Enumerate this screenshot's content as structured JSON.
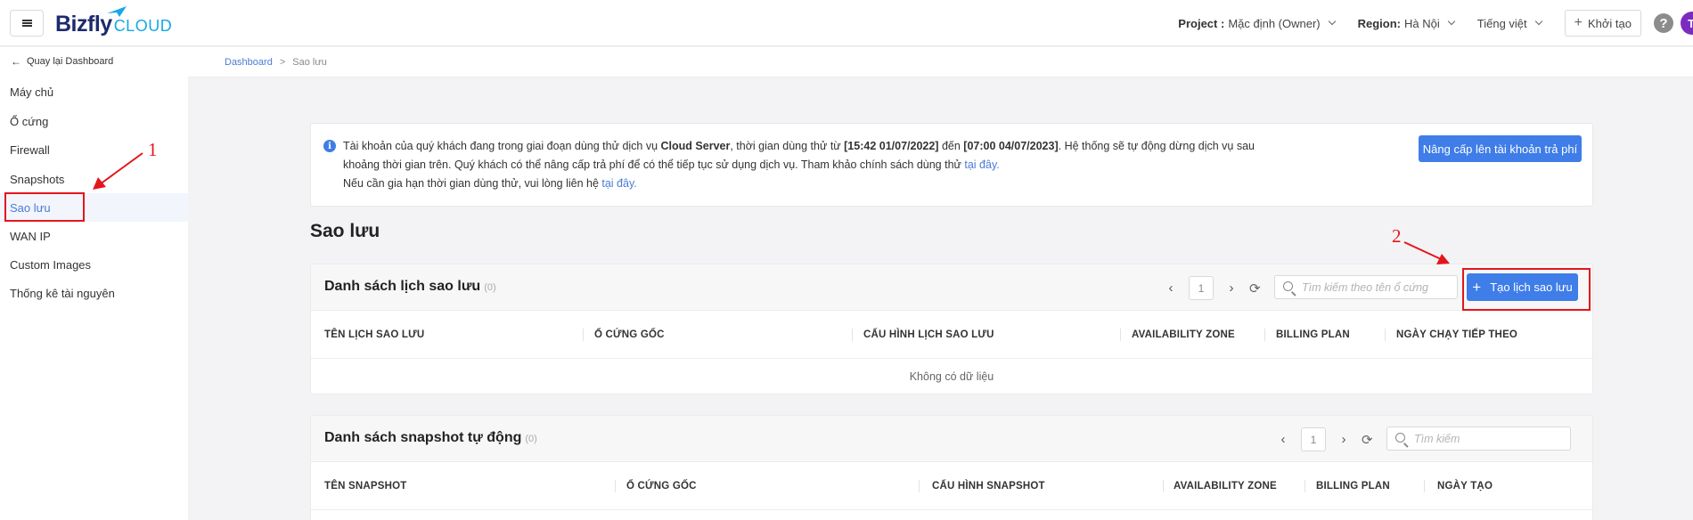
{
  "header": {
    "logo_main": "Bizfly",
    "logo_sub": "CLOUD",
    "project_label": "Project :",
    "project_value": "Mặc định (Owner)",
    "region_label": "Region:",
    "region_value": "Hà Nội",
    "language": "Tiếng việt",
    "create_label": "Khởi tạo",
    "help": "?",
    "avatar": "T"
  },
  "sidebar": {
    "back_label": "Quay lại Dashboard",
    "items": [
      {
        "label": "Máy chủ"
      },
      {
        "label": "Ổ cứng"
      },
      {
        "label": "Firewall"
      },
      {
        "label": "Snapshots"
      },
      {
        "label": "Sao lưu"
      },
      {
        "label": "WAN IP"
      },
      {
        "label": "Custom Images"
      },
      {
        "label": "Thống kê tài nguyên"
      }
    ]
  },
  "breadcrumb": {
    "home": "Dashboard",
    "separator": ">",
    "current": "Sao lưu"
  },
  "notice": {
    "t1": "Tài khoản của quý khách đang trong giai đoạn dùng thử dịch vụ ",
    "b1": "Cloud Server",
    "t2": ", thời gian dùng thử từ ",
    "b2": "[15:42 01/07/2022]",
    "t3": " đến ",
    "b3": "[07:00 04/07/2023]",
    "t4": ". Hệ thống sẽ tự động dừng dịch vụ sau khoảng thời gian trên. Quý khách có thể nâng cấp trả phí để có thể tiếp tục sử dụng dịch vụ. Tham khảo chính sách dùng thử ",
    "link1": "tại đây.",
    "t5": "Nếu cần gia hạn thời gian dùng thử, vui lòng liên hệ ",
    "link2": "tại đây.",
    "upgrade_label": "Nâng cấp lên tài khoản trả phí"
  },
  "page_title": "Sao lưu",
  "backup_panel": {
    "title": "Danh sách lịch sao lưu",
    "count": "(0)",
    "page": "1",
    "search_placeholder": "Tìm kiếm theo tên ổ cứng",
    "create_label": "Tạo lịch sao lưu",
    "columns": [
      "TÊN LỊCH SAO LƯU",
      "Ổ CỨNG GỐC",
      "CẤU HÌNH LỊCH SAO LƯU",
      "AVAILABILITY ZONE",
      "BILLING PLAN",
      "NGÀY CHẠY TIẾP THEO"
    ],
    "empty_text": "Không có dữ liệu"
  },
  "snapshot_panel": {
    "title": "Danh sách snapshot tự động",
    "count": "(0)",
    "page": "1",
    "search_placeholder": "Tìm kiếm",
    "columns": [
      "TÊN SNAPSHOT",
      "Ổ CỨNG GỐC",
      "CẤU HÌNH SNAPSHOT",
      "AVAILABILITY ZONE",
      "BILLING PLAN",
      "NGÀY TẠO"
    ]
  },
  "annotations": {
    "one": "1",
    "two": "2",
    "color": "#e3161c"
  },
  "colors": {
    "primary": "#3f7de8",
    "active_text": "#4a7bd6"
  }
}
